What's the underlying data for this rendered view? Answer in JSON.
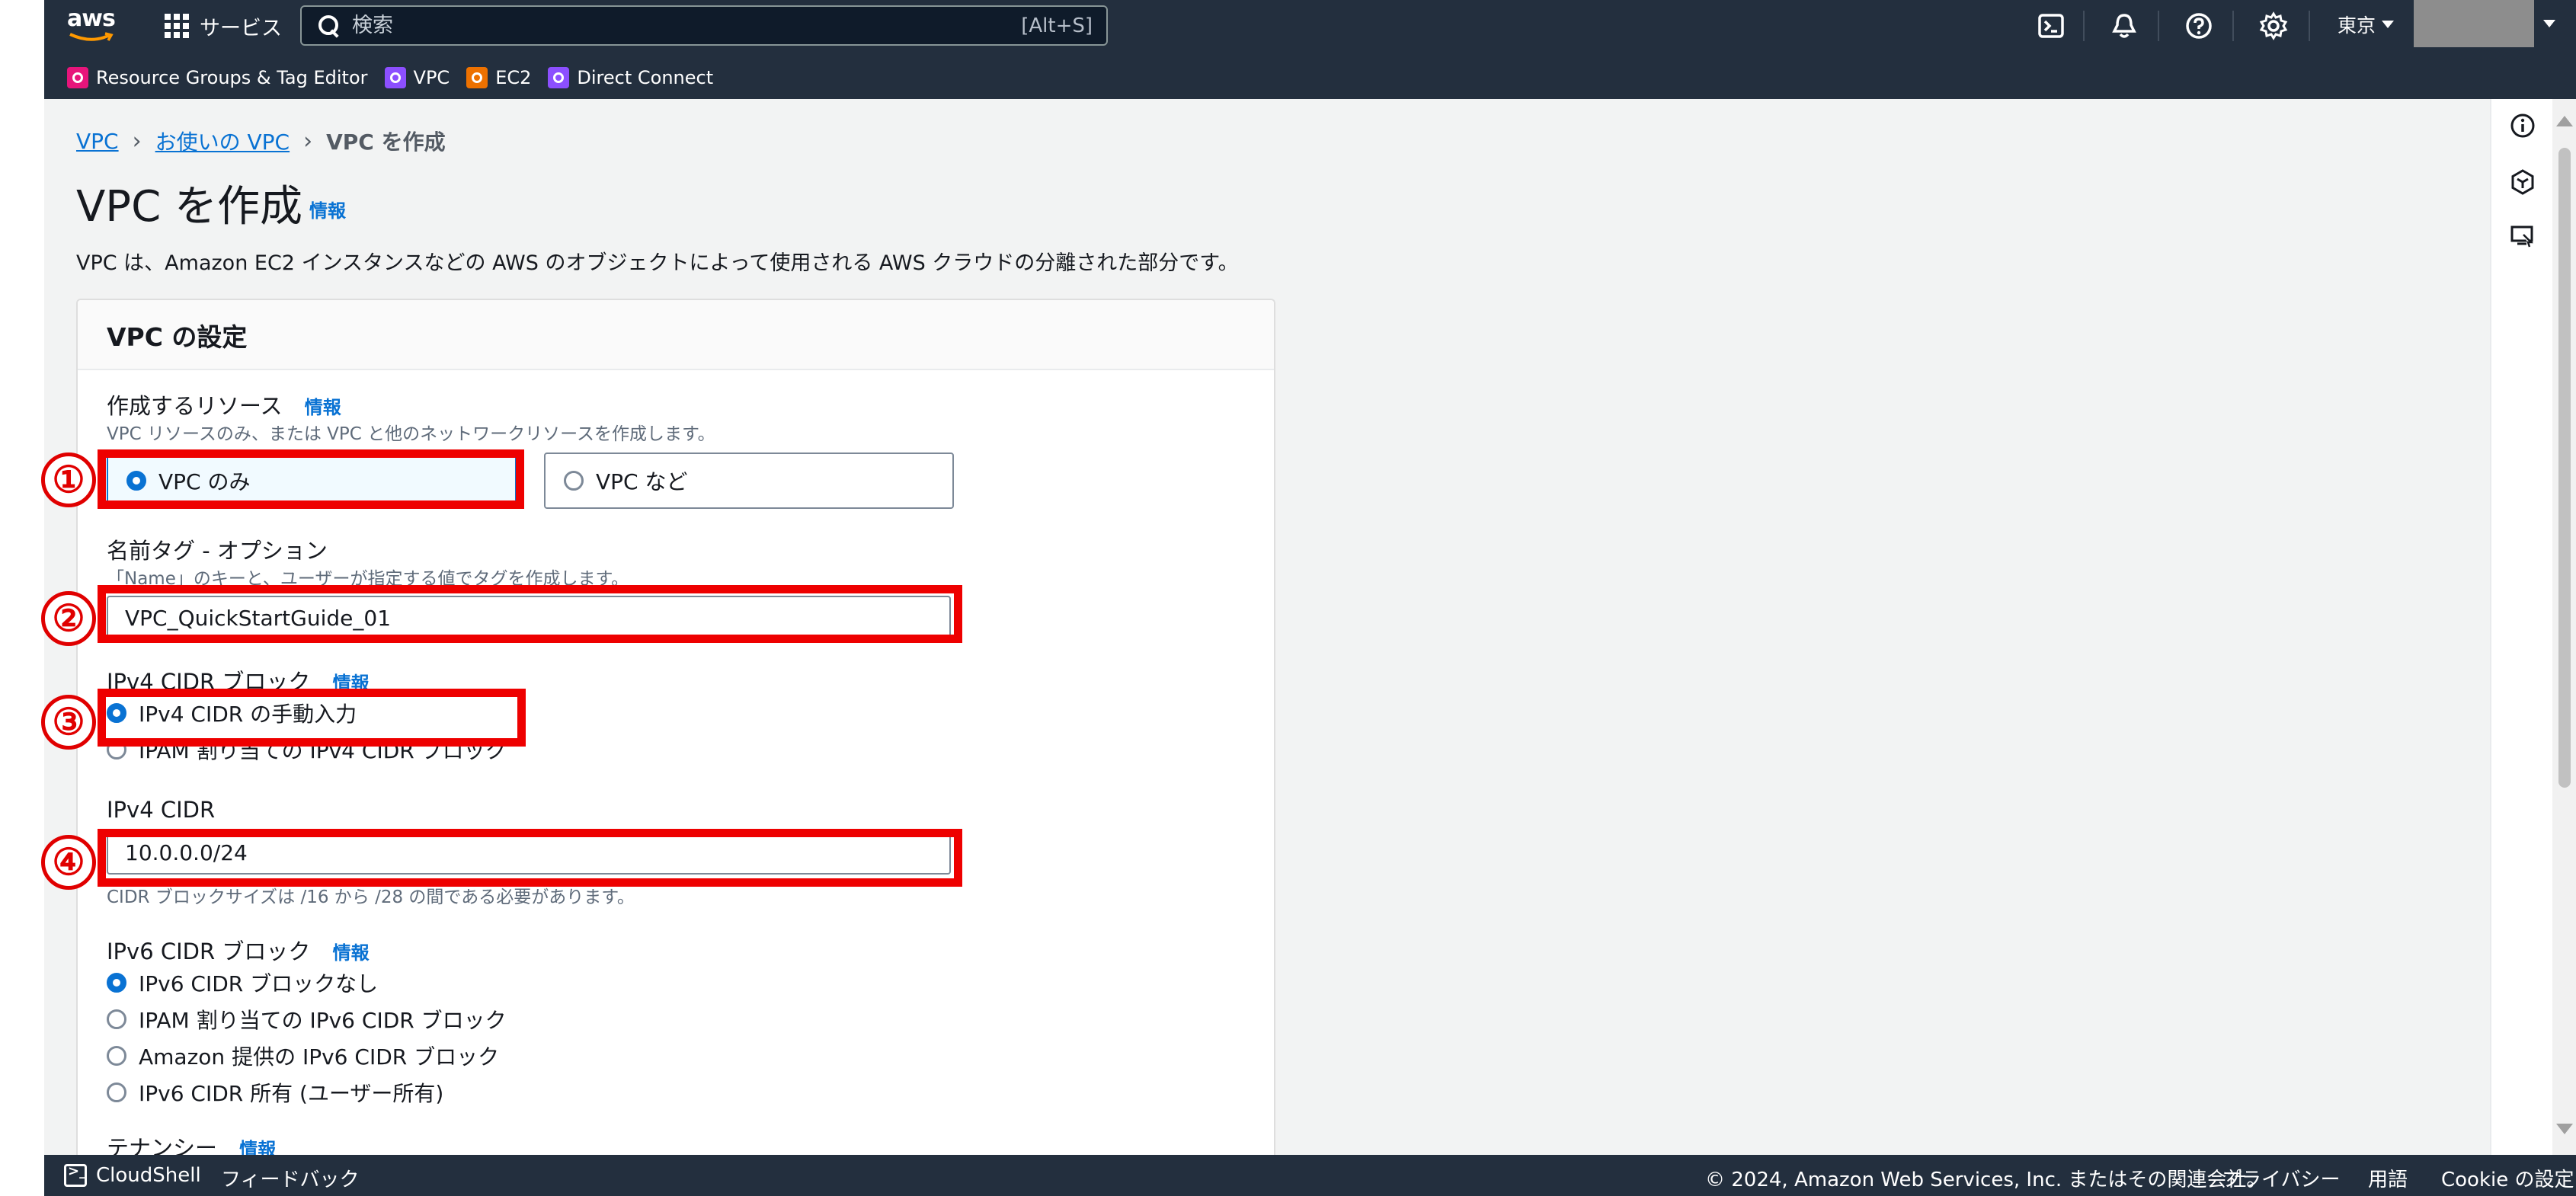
{
  "topnav": {
    "logo_text": "aws",
    "services_label": "サービス",
    "search_placeholder": "検索",
    "search_shortcut": "[Alt+S]",
    "region": "東京",
    "favorites": [
      {
        "label": "Resource Groups & Tag Editor",
        "color": "#e7157b"
      },
      {
        "label": "VPC",
        "color": "#8c4fff"
      },
      {
        "label": "EC2",
        "color": "#ed7100"
      },
      {
        "label": "Direct Connect",
        "color": "#8c4fff"
      }
    ]
  },
  "breadcrumb": {
    "items": [
      "VPC",
      "お使いの VPC"
    ],
    "current": "VPC を作成"
  },
  "page": {
    "title": "VPC を作成",
    "info": "情報",
    "description": "VPC は、Amazon EC2 インスタンスなどの AWS のオブジェクトによって使用される AWS クラウドの分離された部分です。"
  },
  "panel": {
    "title": "VPC の設定",
    "resources": {
      "label": "作成するリソース",
      "info": "情報",
      "description": "VPC リソースのみ、または VPC と他のネットワークリソースを作成します。",
      "options": [
        "VPC のみ",
        "VPC など"
      ],
      "selected": "VPC のみ"
    },
    "name_tag": {
      "label": "名前タグ - オプション",
      "description": "「Name」のキーと、ユーザーが指定する値でタグを作成します。",
      "value": "VPC_QuickStartGuide_01"
    },
    "ipv4_block": {
      "label": "IPv4 CIDR ブロック",
      "info": "情報",
      "options": [
        "IPv4 CIDR の手動入力",
        "IPAM 割り当ての IPv4 CIDR ブロック"
      ],
      "selected": "IPv4 CIDR の手動入力"
    },
    "ipv4_cidr": {
      "label": "IPv4 CIDR",
      "value": "10.0.0.0/24",
      "description": "CIDR ブロックサイズは /16 から /28 の間である必要があります。"
    },
    "ipv6_block": {
      "label": "IPv6 CIDR ブロック",
      "info": "情報",
      "options": [
        "IPv6 CIDR ブロックなし",
        "IPAM 割り当ての IPv6 CIDR ブロック",
        "Amazon 提供の IPv6 CIDR ブロック",
        "IPv6 CIDR 所有 (ユーザー所有)"
      ],
      "selected": "IPv6 CIDR ブロックなし"
    },
    "tenancy": {
      "label": "テナンシー",
      "info": "情報"
    }
  },
  "annotations": [
    "①",
    "②",
    "③",
    "④"
  ],
  "footer": {
    "cloudshell": "CloudShell",
    "feedback": "フィードバック",
    "copyright": "© 2024, Amazon Web Services, Inc. またはその関連会社。",
    "privacy": "プライバシー",
    "terms": "用語",
    "cookie": "Cookie の設定"
  },
  "colors": {
    "nav_bg": "#232f3e",
    "link": "#0972d3",
    "annotation_red": "#ee0000"
  }
}
